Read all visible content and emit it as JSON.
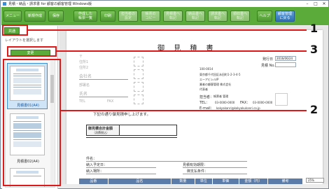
{
  "window": {
    "title": "見積・納品・請求書 for 顧客の顧客管理 Windows版"
  },
  "toolbar": {
    "buttons": [
      {
        "label": "メニュー",
        "style": "normal"
      },
      {
        "label": "新規作成",
        "style": "normal"
      },
      {
        "label": "保存",
        "style": "normal"
      },
      {
        "label": "作成した\n帳票一覧",
        "style": "normal"
      },
      {
        "label": "印刷",
        "style": "normal"
      },
      {
        "label": "担当者の\n設定",
        "style": "dim"
      },
      {
        "label": "帳票の\nコピー",
        "style": "dim"
      },
      {
        "label": "見積書へ\n転記",
        "style": "dim"
      },
      {
        "label": "納品書へ\n転記",
        "style": "dim"
      },
      {
        "label": "請求書へ\n転記",
        "style": "dim"
      },
      {
        "label": "領収書へ\n転記",
        "style": "dim"
      },
      {
        "label": "ヘルプ",
        "style": "normal"
      },
      {
        "label": "顧客管理\nに戻る",
        "style": "blue"
      }
    ]
  },
  "left_panel": {
    "tab_label": "共通",
    "hint": "レイアウトを選択します",
    "change_button": "変更",
    "templates": [
      {
        "label": "見積書01(A4)"
      },
      {
        "label": "見積書02(A4)"
      }
    ]
  },
  "document": {
    "title": "御 見 積 書",
    "issue_date_label": "発行日",
    "issue_date_value": "2016/06/24",
    "number_label": "見積 No.",
    "postal_code": "100-0014",
    "address_line1": "東京都千代田区永田町1-2-3-4-5",
    "address_line2": "エーアビシルIP",
    "company_name": "業者の顧客管理 株式会社",
    "company_sub": "代表者",
    "contact_label": "担当者：",
    "contact_value": "帳票者 管理",
    "tel_label": "TEL：",
    "tel_value": "03-0000-0000",
    "fax_label": "FAX：",
    "fax_value": "03-0000-0000",
    "email_label": "E-mail：",
    "email_value": "kokyakanri@kokyakukanri.co.jp",
    "client_fields": [
      "〒",
      "住所1",
      "住所2",
      "会社名",
      "部署名",
      "氏名",
      "TEL",
      "FAX"
    ],
    "message": "下記の通り御見積申し上げます。",
    "total_label": "御見積合計金額",
    "total_sublabel": "（消費税込）",
    "subject_label": "件名：",
    "delivery_date_label": "納入予定日：",
    "delivery_place_label": "納入場所：",
    "validity_label": "見積有効期限：",
    "payment_label": "御支払条件：",
    "table_headers": [
      "品番",
      "品名",
      "数量",
      "単位",
      "単価",
      "金額（円）",
      "備考"
    ]
  },
  "zoom": {
    "value": "25%"
  },
  "annotations": {
    "callouts": [
      "1",
      "2",
      "3"
    ]
  }
}
